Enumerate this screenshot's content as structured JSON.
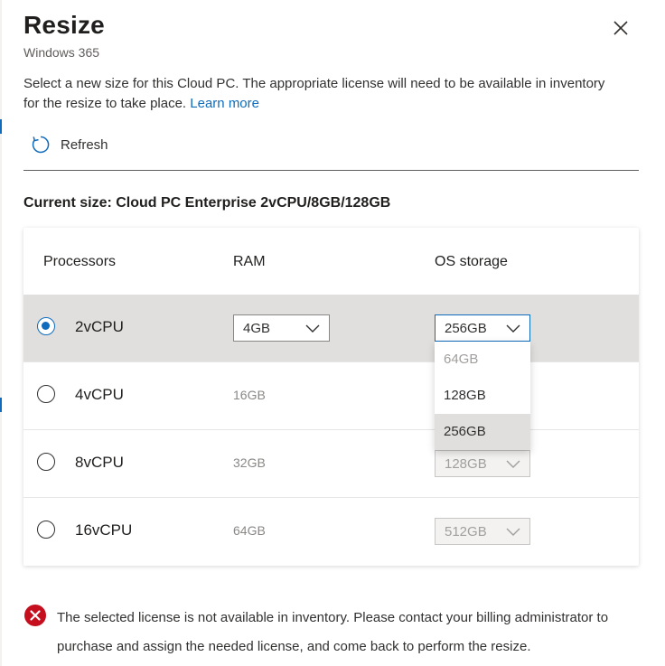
{
  "panel": {
    "title": "Resize",
    "subtitle": "Windows 365",
    "description": "Select a new size for this Cloud PC. The appropriate license will need to be available in inventory for the resize to take place.",
    "learn_more": "Learn more",
    "refresh_label": "Refresh",
    "current_size": "Current size: Cloud PC Enterprise 2vCPU/8GB/128GB"
  },
  "table": {
    "headers": {
      "processors": "Processors",
      "ram": "RAM",
      "storage": "OS storage"
    },
    "rows": [
      {
        "cpu": "2vCPU",
        "ram": "4GB",
        "storage": "256GB",
        "selected": true
      },
      {
        "cpu": "4vCPU",
        "ram": "16GB",
        "storage": "",
        "selected": false
      },
      {
        "cpu": "8vCPU",
        "ram": "32GB",
        "storage": "128GB",
        "selected": false
      },
      {
        "cpu": "16vCPU",
        "ram": "64GB",
        "storage": "512GB",
        "selected": false
      }
    ]
  },
  "storage_dropdown": {
    "options": [
      {
        "label": "64GB",
        "disabled": true
      },
      {
        "label": "128GB",
        "disabled": false
      },
      {
        "label": "256GB",
        "disabled": false,
        "highlighted": true
      }
    ]
  },
  "error": {
    "message": "The selected license is not available in inventory. Please contact your billing administrator to purchase and assign the needed license, and come back to perform the resize."
  },
  "colors": {
    "accent": "#0f6cbd",
    "selected_row": "#e1dfdd",
    "error": "#c50f1f"
  },
  "icons": {
    "close": "close-icon",
    "refresh": "refresh-icon",
    "chevron": "chevron-down-icon",
    "error": "error-circle-icon"
  }
}
